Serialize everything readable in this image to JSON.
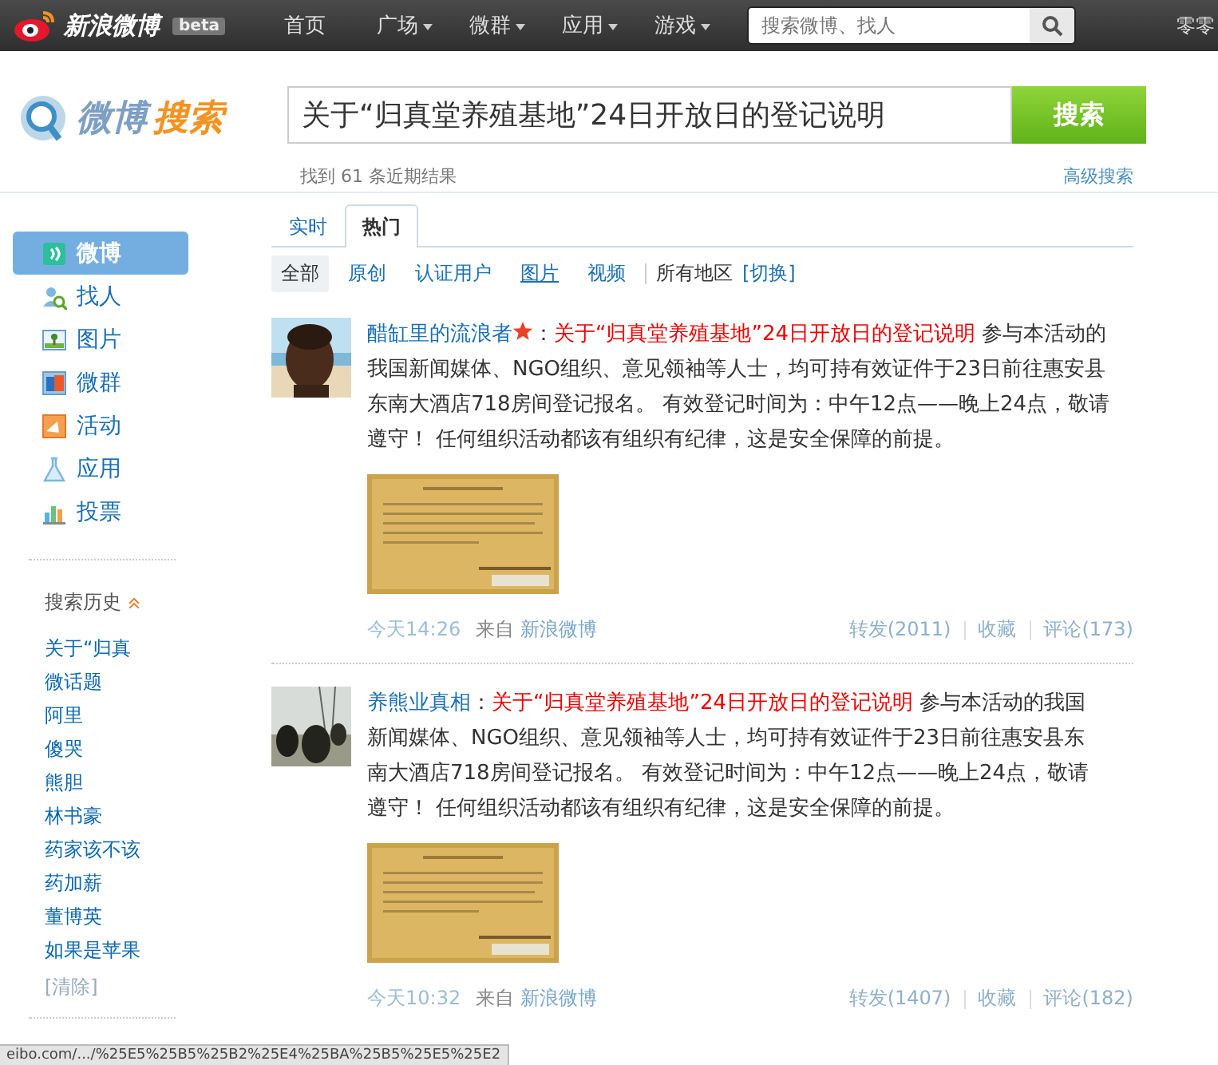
{
  "top_nav": {
    "logo": "新浪微博",
    "badge": "beta",
    "items": [
      {
        "label": "首页",
        "dropdown": false
      },
      {
        "label": "广场",
        "dropdown": true
      },
      {
        "label": "微群",
        "dropdown": true
      },
      {
        "label": "应用",
        "dropdown": true
      },
      {
        "label": "游戏",
        "dropdown": true
      }
    ],
    "search": {
      "placeholder": "搜索微博、找人"
    },
    "user": "零零"
  },
  "search_header": {
    "logo_part1": "微博",
    "logo_part2": "搜索",
    "query": "关于“归真堂养殖基地”24日开放日的登记说明",
    "button": "搜索",
    "result_count": "找到 61 条近期结果",
    "advanced": "高级搜索"
  },
  "sidebar": {
    "items": [
      {
        "label": "微博",
        "selected": true
      },
      {
        "label": "找人",
        "selected": false
      },
      {
        "label": "图片",
        "selected": false
      },
      {
        "label": "微群",
        "selected": false
      },
      {
        "label": "活动",
        "selected": false
      },
      {
        "label": "应用",
        "selected": false
      },
      {
        "label": "投票",
        "selected": false
      }
    ],
    "history_title": "搜索历史",
    "history": [
      "关于“归真",
      "微话题",
      "阿里",
      "傻哭",
      "熊胆",
      "林书豪",
      "药家该不该",
      "药加薪",
      "董博英",
      "如果是苹果"
    ],
    "clear": "[清除]"
  },
  "tabs": [
    {
      "label": "实时",
      "selected": false
    },
    {
      "label": "热门",
      "selected": true
    }
  ],
  "filters": [
    {
      "label": "全部",
      "selected": true
    },
    {
      "label": "原创",
      "selected": false
    },
    {
      "label": "认证用户",
      "selected": false
    },
    {
      "label": "图片",
      "selected": false
    },
    {
      "label": "视频",
      "selected": false
    }
  ],
  "region": {
    "label": "所有地区",
    "switch": "[切换]"
  },
  "posts": [
    {
      "author": "醋缸里的流浪者",
      "verified": true,
      "colon": "：",
      "title": "关于“归真堂养殖基地”24日开放日的登记说明",
      "body": "参与本活动的我国新闻媒体、NGO组织、意见领袖等人士，均可持有效证件于23日前往惠安县东南大酒店718房间登记报名。 有效登记时间为：中午12点——晚上24点，敬请遵守！ 任何组织活动都该有组织有纪律，这是安全保障的前提。",
      "time": "今天14:26",
      "from": "来自",
      "source": "新浪微博",
      "actions": [
        "转发(2011)",
        "收藏",
        "评论(173)"
      ]
    },
    {
      "author": "养熊业真相",
      "verified": false,
      "colon": "：",
      "title": "关于“归真堂养殖基地”24日开放日的登记说明",
      "body": "参与本活动的我国新闻媒体、NGO组织、意见领袖等人士，均可持有效证件于23日前往惠安县东南大酒店718房间登记报名。 有效登记时间为：中午12点——晚上24点，敬请遵守！ 任何组织活动都该有组织有纪律，这是安全保障的前提。",
      "time": "今天10:32",
      "from": "来自",
      "source": "新浪微博",
      "actions": [
        "转发(1407)",
        "收藏",
        "评论(182)"
      ]
    }
  ],
  "status_bar": "eibo.com/.../%25E5%25B5%25B2%25E4%25BA%25B5%25E5%25E2"
}
